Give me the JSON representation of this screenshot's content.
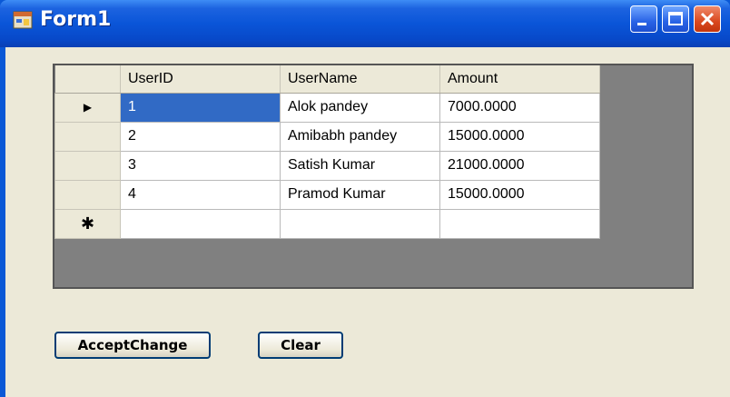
{
  "window": {
    "title": "Form1",
    "app_icon": "form-app-icon"
  },
  "title_controls": [
    "minimize-icon",
    "maximize-icon",
    "close-icon"
  ],
  "grid": {
    "columns": [
      "UserID",
      "UserName",
      "Amount"
    ],
    "rows": [
      {
        "marker": "▶",
        "UserID": "1",
        "UserName": "Alok pandey",
        "Amount": "7000.0000"
      },
      {
        "marker": "",
        "UserID": "2",
        "UserName": "Amibabh pandey",
        "Amount": "15000.0000"
      },
      {
        "marker": "",
        "UserID": "3",
        "UserName": "Satish Kumar",
        "Amount": "21000.0000"
      },
      {
        "marker": "",
        "UserID": "4",
        "UserName": "Pramod Kumar",
        "Amount": "15000.0000"
      }
    ],
    "new_row_marker": "✱"
  },
  "buttons": {
    "accept": "AcceptChange",
    "clear": "Clear"
  },
  "colors": {
    "title_bar": "#0a55d8",
    "client": "#ece9d8",
    "selection": "#316ac5"
  }
}
